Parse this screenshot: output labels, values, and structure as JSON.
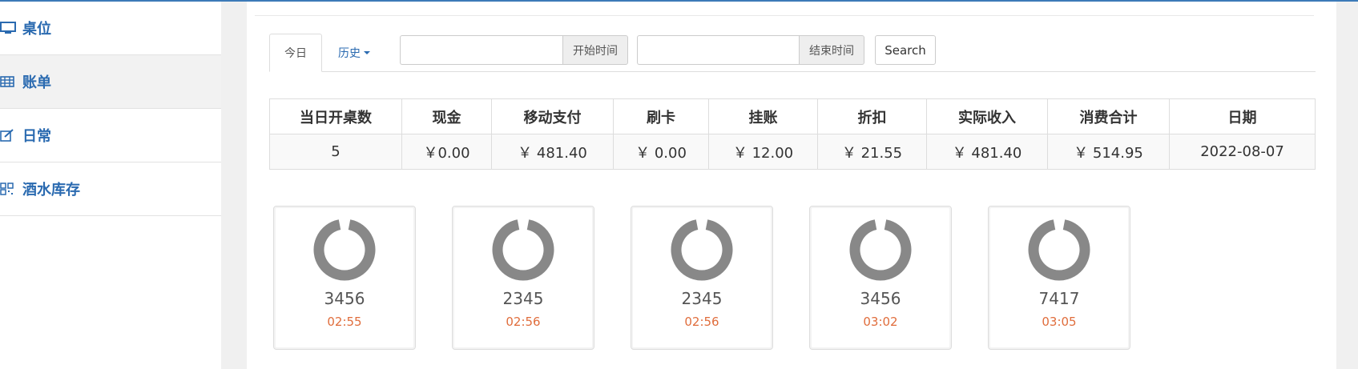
{
  "sidebar": {
    "items": [
      {
        "label": "桌位",
        "icon": "monitor-icon"
      },
      {
        "label": "账单",
        "icon": "table-grid-icon"
      },
      {
        "label": "日常",
        "icon": "edit-icon"
      },
      {
        "label": "酒水库存",
        "icon": "qrcode-icon"
      }
    ]
  },
  "tabs": {
    "today": "今日",
    "history": "历史"
  },
  "filters": {
    "start_value": "",
    "start_label": "开始时间",
    "end_value": "",
    "end_label": "结束时间",
    "search_label": "Search"
  },
  "summary_table": {
    "headers": [
      "当日开桌数",
      "现金",
      "移动支付",
      "刷卡",
      "挂账",
      "折扣",
      "实际收入",
      "消费合计",
      "日期"
    ],
    "row": [
      "5",
      "￥0.00",
      "￥ 481.40",
      "￥ 0.00",
      "￥ 12.00",
      "￥ 21.55",
      "￥ 481.40",
      "￥ 514.95",
      "2022-08-07"
    ]
  },
  "tables": [
    {
      "number": "3456",
      "time": "02:55"
    },
    {
      "number": "2345",
      "time": "02:56"
    },
    {
      "number": "2345",
      "time": "02:56"
    },
    {
      "number": "3456",
      "time": "03:02"
    },
    {
      "number": "7417",
      "time": "03:05"
    }
  ],
  "colors": {
    "accent": "#2a6ab0",
    "time": "#e06d3c",
    "ring": "#888888"
  }
}
